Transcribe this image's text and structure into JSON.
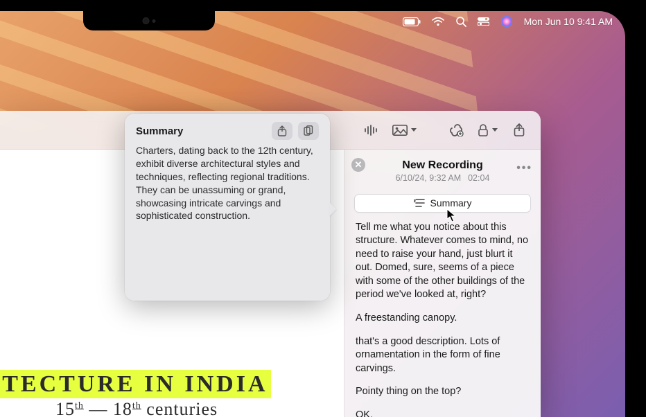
{
  "menubar": {
    "datetime": "Mon Jun 10  9:41 AM",
    "icons": [
      "battery",
      "wifi",
      "search",
      "control-center",
      "siri"
    ]
  },
  "notes": {
    "toolbar": {
      "audio_icon": "waveform",
      "photos_icon": "photo",
      "link_icon": "link-plus",
      "lock_icon": "lock",
      "share_icon": "share"
    },
    "canvas": {
      "highlight_text": "ITECTURE IN INDIA",
      "subline_prefix": "15",
      "subline_sup1": "th",
      "subline_mid": " — 18",
      "subline_sup2": "th",
      "subline_suffix": " centuries"
    },
    "recording": {
      "title": "New Recording",
      "date": "6/10/24, 9:32 AM",
      "duration": "02:04",
      "summary_label": "Summary",
      "transcript": [
        "Tell me what you notice about this structure. Whatever comes to mind, no need to raise your hand, just blurt it out. Domed, sure, seems of a piece with some of the other buildings of the period we've looked at, right?",
        "A freestanding canopy.",
        "that's a good description. Lots of ornamentation in the form of fine carvings.",
        "Pointy thing on the top?",
        "OK."
      ]
    }
  },
  "popover": {
    "title": "Summary",
    "body": "Charters, dating back to the 12th century, exhibit diverse architectural styles and techniques, reflecting regional traditions. They can be unassuming or grand, showcasing intricate carvings and sophisticated construction."
  }
}
